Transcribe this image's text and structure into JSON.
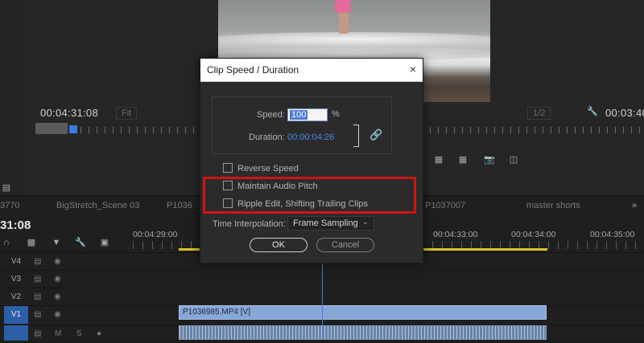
{
  "program_monitor": {
    "left_timecode": "00:04:31:08",
    "fit_label": "Fit",
    "right_zoom": "1/2",
    "right_timecode": "00:03:40"
  },
  "tabs": [
    "3770",
    "BigStretch_Scene 03",
    "P1036",
    "P1037007",
    "master shorts"
  ],
  "timeline": {
    "current_timecode": "31:08",
    "ruler_times": [
      "00:04:29:00",
      "00:04:33:00",
      "00:04:34:00",
      "00:04:35:00"
    ],
    "tracks": [
      {
        "name": "V4",
        "active": false
      },
      {
        "name": "V3",
        "active": false
      },
      {
        "name": "V2",
        "active": false
      },
      {
        "name": "V1",
        "active": true
      }
    ],
    "clip_v1_label": "P1036985.MP4 [V]"
  },
  "dialog": {
    "title": "Clip Speed / Duration",
    "close_glyph": "×",
    "speed_label": "Speed:",
    "speed_value": "100",
    "percent": "%",
    "duration_label": "Duration:",
    "duration_value": "00:00:04:26",
    "reverse_speed": "Reverse Speed",
    "maintain_audio_pitch": "Maintain Audio Pitch",
    "ripple_edit": "Ripple Edit, Shifting Trailing Clips",
    "interp_label": "Time Interpolation:",
    "interp_value": "Frame Sampling",
    "ok": "OK",
    "cancel": "Cancel"
  },
  "colors": {
    "highlight": "#d01414",
    "timecode_blue": "#4a8ef0",
    "active_track": "#2d5ea8"
  },
  "icons": [
    "link-icon",
    "chevron-down-icon",
    "wrench-icon",
    "camera-icon",
    "eye-icon"
  ]
}
